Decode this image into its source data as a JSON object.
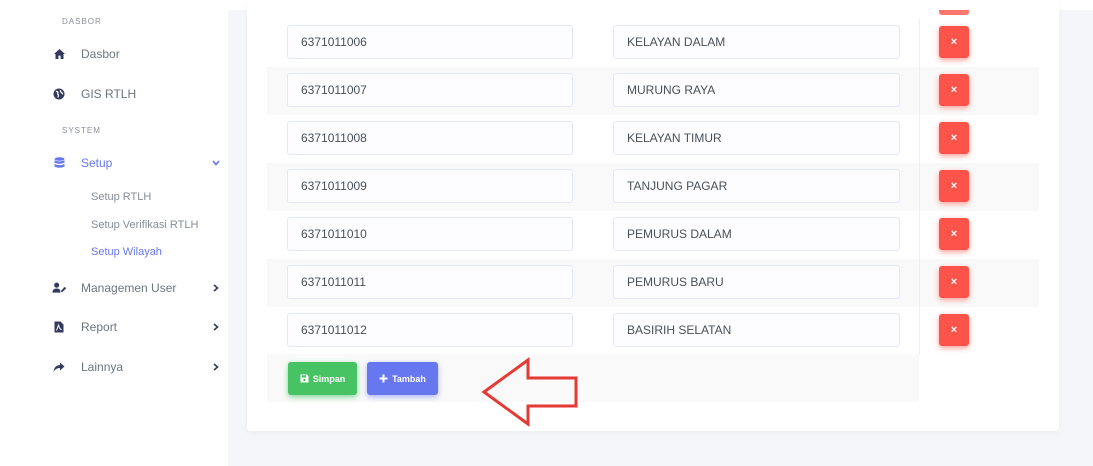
{
  "sidebar": {
    "section_dasbor": "DASBOR",
    "section_system": "SYSTEM",
    "dasbor": "Dasbor",
    "gis": "GIS RTLH",
    "setup": "Setup",
    "setup_items": [
      "Setup RTLH",
      "Setup Verifikasi RTLH",
      "Setup Wilayah"
    ],
    "managemen_user": "Managemen User",
    "report": "Report",
    "lainnya": "Lainnya",
    "active_sub_item": "Setup Wilayah"
  },
  "wilayah_rows": [
    {
      "kode": "6371011006",
      "nama": "KELAYAN DALAM"
    },
    {
      "kode": "6371011007",
      "nama": "MURUNG RAYA"
    },
    {
      "kode": "6371011008",
      "nama": "KELAYAN TIMUR"
    },
    {
      "kode": "6371011009",
      "nama": "TANJUNG PAGAR"
    },
    {
      "kode": "6371011010",
      "nama": "PEMURUS DALAM"
    },
    {
      "kode": "6371011011",
      "nama": "PEMURUS BARU"
    },
    {
      "kode": "6371011012",
      "nama": "BASIRIH SELATAN"
    }
  ],
  "actions": {
    "delete_glyph": "×",
    "save_label": "Simpan",
    "add_label": "Tambah"
  },
  "colors": {
    "primary": "#6777ef",
    "success": "#47c363",
    "danger": "#fc544b",
    "annotation_arrow": "#e53935"
  }
}
